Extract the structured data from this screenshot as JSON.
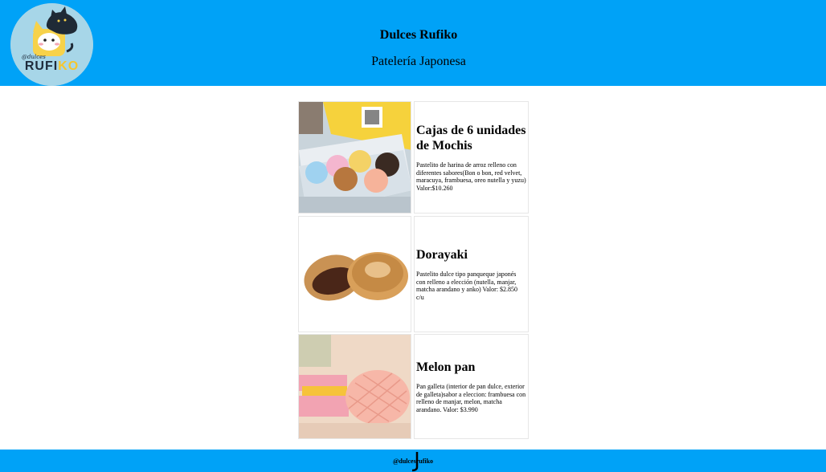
{
  "header": {
    "title": "Dulces Rufiko",
    "subtitle": "Patelería Japonesa",
    "logo": {
      "text_main": "RUFI",
      "text_accent": "KO",
      "text_small": "@dulces"
    }
  },
  "products": [
    {
      "name": "Cajas de 6 unidades de Mochis",
      "description": "Pastelito de harina de arroz relleno con diferentes sabores(Bon o bon, red velvet, maracuya, frambuesa, oreo nutella y yuzu) Valor:$10.260",
      "image": "mochi-box-photo"
    },
    {
      "name": "Dorayaki",
      "description": "Pastelito dulce tipo panqueque japonés con relleno a elección (nutella, manjar, matcha arandano y anko) Valor: $2.850 c/u",
      "image": "dorayaki-photo"
    },
    {
      "name": "Melon pan",
      "description": "Pan galleta (interior de pan dulce, exterior de galleta)sabor a eleccion: frambuesa con relleno de manjar, melon, matcha arandano. Valor: $3.990",
      "image": "melon-pan-photo"
    }
  ],
  "footer": {
    "text": "@dulcesrufiko"
  },
  "colors": {
    "header_bg": "#00a2f7",
    "footer_bg": "#00a2f7",
    "page_bg": "#ffffff"
  }
}
